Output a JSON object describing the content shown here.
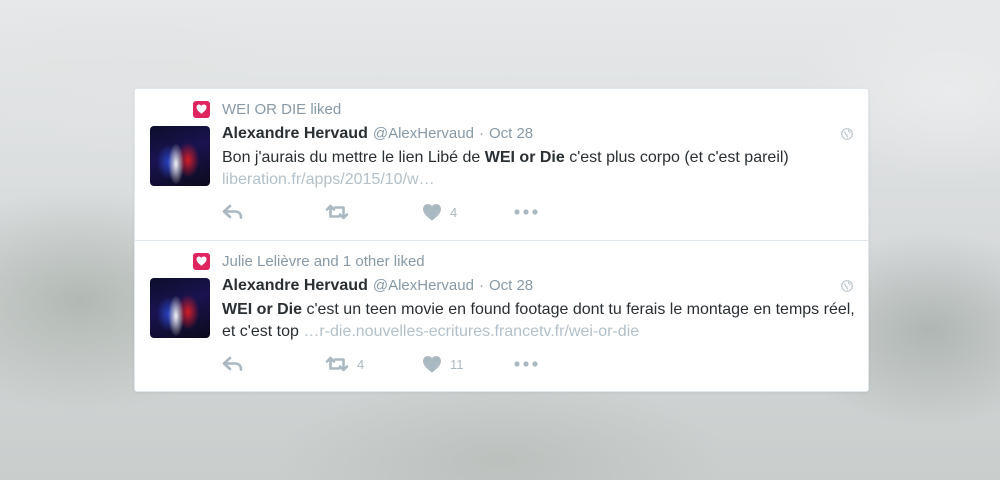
{
  "tweets": [
    {
      "context": "WEI OR DIE liked",
      "author_name": "Alexandre Hervaud",
      "handle": "@AlexHervaud",
      "separator": "·",
      "date": "Oct 28",
      "text_before": "Bon j'aurais du mettre le lien Libé de ",
      "text_bold": "WEI or Die",
      "text_after": " c'est plus corpo (et c'est pareil)",
      "link": "liberation.fr/apps/2015/10/w…",
      "retweet_count": "",
      "like_count": "4"
    },
    {
      "context": "Julie Lelièvre and 1 other liked",
      "author_name": "Alexandre Hervaud",
      "handle": "@AlexHervaud",
      "separator": "·",
      "date": "Oct 28",
      "text_bold": "WEI or Die",
      "text_after": " c'est un teen movie en found footage dont tu ferais le montage en temps réel, et c'est top ",
      "link": "…r-die.nouvelles-ecritures.francetv.fr/wei-or-die",
      "retweet_count": "4",
      "like_count": "11"
    }
  ],
  "colors": {
    "like_badge": "#e0245e",
    "name": "#292f33",
    "muted": "#8899a6",
    "link": "#b3c0ca",
    "action_icon": "#aab8c2"
  },
  "icons": [
    "heart-icon",
    "globe-icon",
    "reply-icon",
    "retweet-icon",
    "like-icon",
    "more-icon"
  ]
}
